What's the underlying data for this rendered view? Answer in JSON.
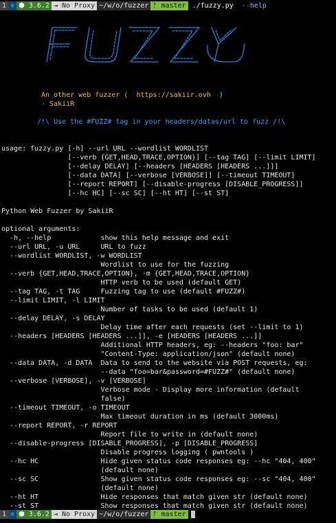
{
  "prompt": {
    "index": "1",
    "react_icon": "react-icon",
    "node_version": "3.6.2",
    "proxy": "No Proxy",
    "path": "~/w/o/fuzzer",
    "branch": "master",
    "command": "./fuzzy.py",
    "flag": "--help"
  },
  "banner": {
    "logo_text": "FUZZY",
    "tagline": "An other web fuzzer (  https://sakiir.ovh  )",
    "author": "- SakiiR",
    "hint": "/!\\ Use the #FUZZ# tag in your headers/datas/url to fuzz /!\\"
  },
  "help_lines": [
    "usage: fuzzy.py [-h] --url URL --wordlist WORDLIST",
    "                [--verb {GET,HEAD,TRACE,OPTION}] [--tag TAG] [--limit LIMIT]",
    "                [--delay DELAY] [--headers [HEADERS [HEADERS ...]]]",
    "                [--data DATA] [--verbose [VERBOSE]] [--timeout TIMEOUT]",
    "                [--report REPORT] [--disable-progress [DISABLE_PROGRESS]]",
    "                [--hc HC] [--sc SC] [--ht HT] [--st ST]",
    "",
    "Python Web Fuzzer by SakiiR",
    "",
    "optional arguments:",
    "  -h, --help            show this help message and exit",
    "  --url URL, -u URL     URL to fuzz",
    "  --wordlist WORDLIST, -w WORDLIST",
    "                        Wordlist to use for the fuzzing",
    "  --verb {GET,HEAD,TRACE,OPTION}, -m {GET,HEAD,TRACE,OPTION}",
    "                        HTTP verb to be used (default GET)",
    "  --tag TAG, -t TAG     Fuzzing tag to use (default #FUZZ#)",
    "  --limit LIMIT, -l LIMIT",
    "                        Number of tasks to be used (default 1)",
    "  --delay DELAY, -s DELAY",
    "                        Delay time after each requests (set --limit to 1)",
    "  --headers [HEADERS [HEADERS ...]], -e [HEADERS [HEADERS ...]]",
    "                        Additional HTTP headers, eg: --headers \"foo: bar\"",
    "                        \"Content-Type: application/json\" (default none)",
    "  --data DATA, -d DATA  Data to send to the website via POST requests, eg:",
    "                        --data \"foo=bar&password=#FUZZ#\" (default none)",
    "  --verbose [VERBOSE], -v [VERBOSE]",
    "                        Verbose mode - Display more information (default",
    "                        false)",
    "  --timeout TIMEOUT, -o TIMEOUT",
    "                        Max timeout duration in ms (default 3000ms)",
    "  --report REPORT, -r REPORT",
    "                        Report file to write in (default none)",
    "  --disable-progress [DISABLE_PROGRESS], -p [DISABLE_PROGRESS]",
    "                        Disable progress logging ( pwntools )",
    "  --hc HC               Hide given status code responses eg: --hc \"404, 400\"",
    "                        (default none)",
    "  --sc SC               Show given status code responses eg: --sc \"404, 400\"",
    "                        (default none)",
    "  --ht HT               Hide responses that match given str (default none)",
    "  --st ST               Show responses that match given str (default none)"
  ],
  "colors": {
    "background": "#000000",
    "logo": "#1e88e5",
    "tagline": "#f0c040",
    "hint": "#3aa0ff"
  }
}
